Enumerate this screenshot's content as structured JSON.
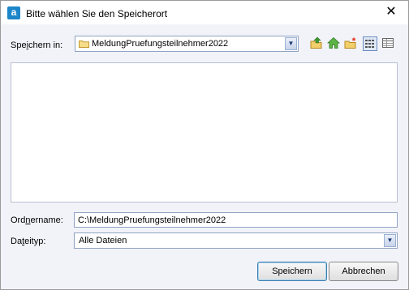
{
  "window": {
    "title": "Bitte wählen Sie den Speicherort",
    "app_icon_letter": "a",
    "close_glyph": "✕"
  },
  "save_in": {
    "label_pre": "Spe",
    "label_accel": "i",
    "label_post": "chern in:",
    "value": "MeldungPruefungsteilnehmer2022"
  },
  "toolbar": {
    "icons": [
      "folder-up-icon",
      "home-icon",
      "new-folder-icon",
      "list-view-icon",
      "details-view-icon"
    ]
  },
  "folder_name": {
    "label_pre": "Ord",
    "label_accel": "n",
    "label_post": "ername:",
    "value": "C:\\MeldungPruefungsteilnehmer2022"
  },
  "file_type": {
    "label_pre": "Da",
    "label_accel": "t",
    "label_post": "eityp:",
    "value": "Alle Dateien"
  },
  "buttons": {
    "save": "Speichern",
    "cancel": "Abbrechen"
  },
  "colors": {
    "accent": "#1d86c9",
    "dialog_bg": "#f2f3f9",
    "border": "#8fa2c2"
  }
}
